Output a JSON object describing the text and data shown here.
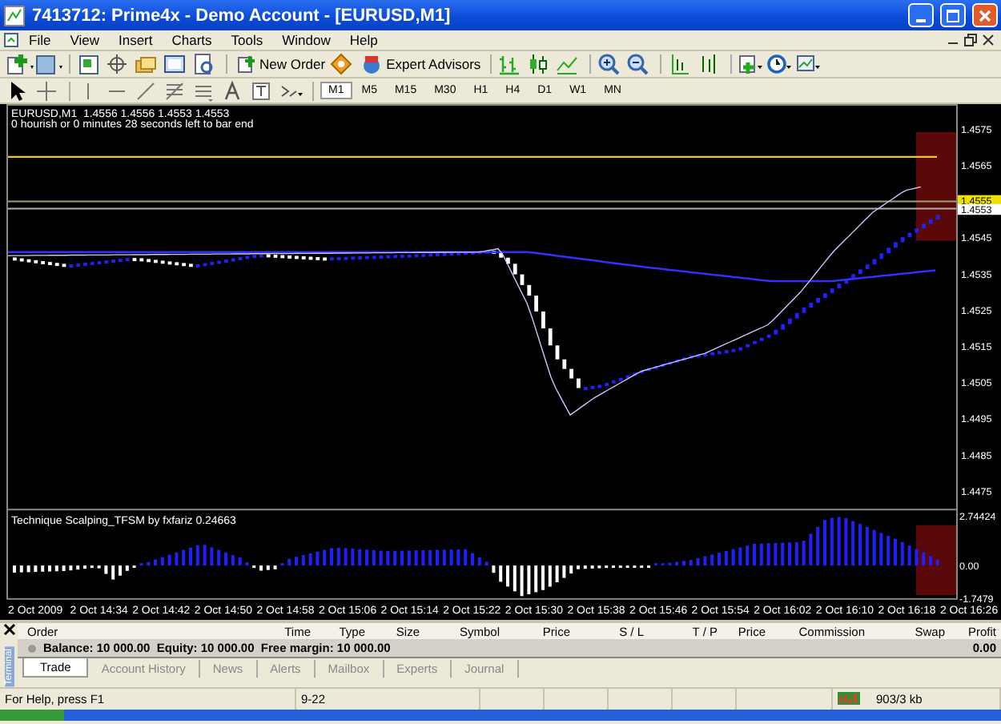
{
  "window": {
    "title": "7413712: Prime4x - Demo Account - [EURUSD,M1]"
  },
  "menu": [
    "File",
    "View",
    "Insert",
    "Charts",
    "Tools",
    "Window",
    "Help"
  ],
  "toolbar": {
    "new_order": "New Order",
    "expert_advisors": "Expert Advisors"
  },
  "timeframes": [
    {
      "label": "M1",
      "selected": true
    },
    {
      "label": "M5",
      "selected": false
    },
    {
      "label": "M15",
      "selected": false
    },
    {
      "label": "M30",
      "selected": false
    },
    {
      "label": "H1",
      "selected": false
    },
    {
      "label": "H4",
      "selected": false
    },
    {
      "label": "D1",
      "selected": false
    },
    {
      "label": "W1",
      "selected": false
    },
    {
      "label": "MN",
      "selected": false
    }
  ],
  "chart": {
    "header": "EURUSD,M1  1.4556 1.4556 1.4553 1.4553",
    "countdown": "0 hourish or 0 minutes 28 seconds left to bar end",
    "price_axis": [
      "1.4575",
      "1.4565",
      "1.4545",
      "1.4535",
      "1.4525",
      "1.4515",
      "1.4505",
      "1.4495",
      "1.4485",
      "1.4475"
    ],
    "bid_label": "1.4555",
    "last_label": "1.4553",
    "indicator": {
      "title": "Technique Scalping_TFSM by fxfariz 0.24663",
      "axis": [
        "2.74424",
        "0.00",
        "-1.7479"
      ]
    },
    "time_axis": [
      "2 Oct 2009",
      "2 Oct 14:34",
      "2 Oct 14:42",
      "2 Oct 14:50",
      "2 Oct 14:58",
      "2 Oct 15:06",
      "2 Oct 15:14",
      "2 Oct 15:22",
      "2 Oct 15:30",
      "2 Oct 15:38",
      "2 Oct 15:46",
      "2 Oct 15:54",
      "2 Oct 16:02",
      "2 Oct 16:10",
      "2 Oct 16:18",
      "2 Oct 16:26"
    ]
  },
  "terminal": {
    "side_label": "Terminal",
    "columns": [
      "Order",
      "Time",
      "Type",
      "Size",
      "Symbol",
      "Price",
      "S / L",
      "T / P",
      "Price",
      "Commission",
      "Swap",
      "Profit"
    ],
    "balance": "Balance: 10 000.00  Equity: 10 000.00  Free margin: 10 000.00",
    "profit": "0.00",
    "tabs": [
      {
        "label": "Trade",
        "selected": true
      },
      {
        "label": "Account History",
        "selected": false
      },
      {
        "label": "News",
        "selected": false
      },
      {
        "label": "Alerts",
        "selected": false
      },
      {
        "label": "Mailbox",
        "selected": false
      },
      {
        "label": "Experts",
        "selected": false
      },
      {
        "label": "Journal",
        "selected": false
      }
    ]
  },
  "status_bar": {
    "help": "For Help, press F1",
    "profile": "9-22",
    "traffic": "903/3 kb"
  }
}
